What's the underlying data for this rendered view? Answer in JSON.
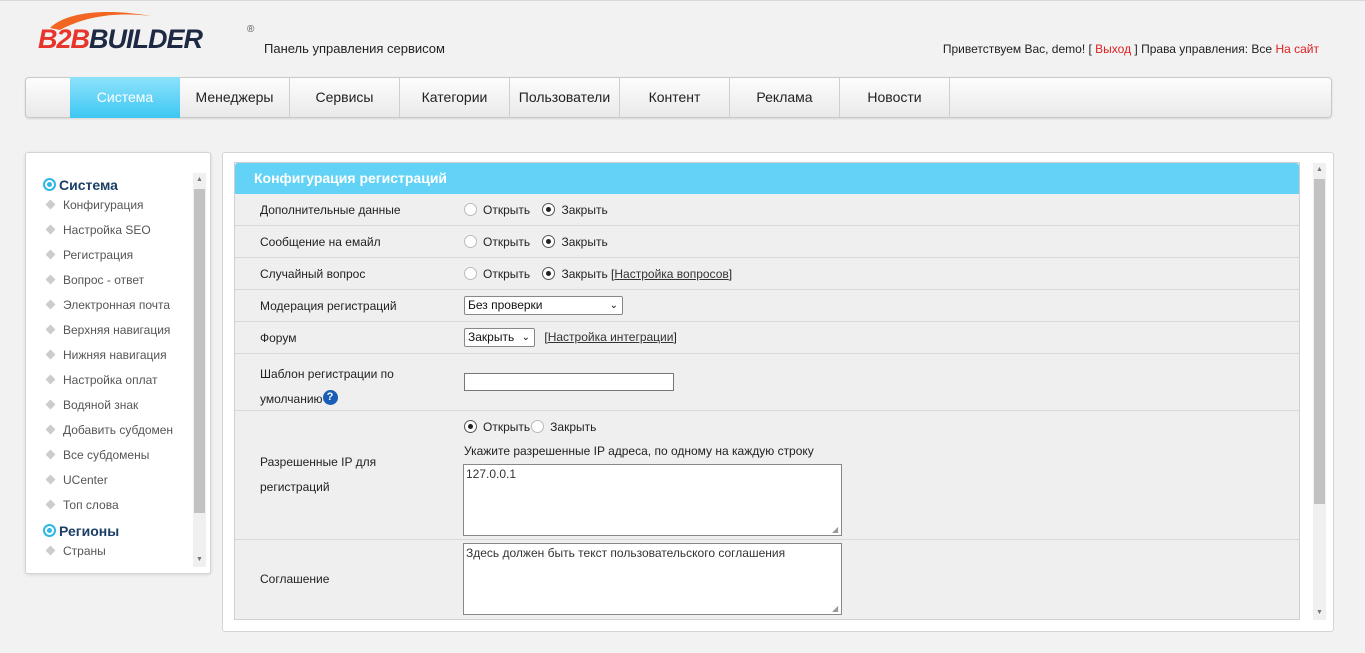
{
  "header": {
    "logo_text": "B2BBUILDER",
    "logo_reg": "®",
    "panel_title": "Панель управления сервисом",
    "welcome_prefix": "Приветствуем Вас, demo! [",
    "logout_label": "Выход",
    "rights_text": "] Права управления: Все",
    "site_link": "На сайт"
  },
  "nav": {
    "items": [
      {
        "label": "Система"
      },
      {
        "label": "Менеджеры"
      },
      {
        "label": "Сервисы"
      },
      {
        "label": "Категории"
      },
      {
        "label": "Пользователи"
      },
      {
        "label": "Контент"
      },
      {
        "label": "Реклама"
      },
      {
        "label": "Новости"
      }
    ]
  },
  "sidebar": {
    "group1": "Система",
    "items": [
      {
        "label": "Конфигурация"
      },
      {
        "label": "Настройка SEO"
      },
      {
        "label": "Регистрация"
      },
      {
        "label": "Вопрос - ответ"
      },
      {
        "label": "Электронная почта"
      },
      {
        "label": "Верхняя навигация"
      },
      {
        "label": "Нижняя навигация"
      },
      {
        "label": "Настройка оплат"
      },
      {
        "label": "Водяной знак"
      },
      {
        "label": "Добавить субдомен"
      },
      {
        "label": "Все субдомены"
      },
      {
        "label": "UCenter"
      },
      {
        "label": "Топ слова"
      }
    ],
    "group2": "Регионы",
    "group2_items": [
      {
        "label": "Страны"
      }
    ]
  },
  "form": {
    "title": "Конфигурация регистраций",
    "opt_open": "Открыть",
    "opt_close": "Закрыть",
    "rows": {
      "extra_data": {
        "label": "Дополнительные данные",
        "selected": "Закрыть"
      },
      "email_message": {
        "label": "Сообщение на емайл",
        "selected": "Закрыть"
      },
      "random_question": {
        "label": "Случайный вопрос",
        "selected": "Закрыть",
        "link": "Настройка вопросов"
      },
      "moderation": {
        "label": "Модерация регистраций",
        "value": "Без проверки"
      },
      "forum": {
        "label": "Форум",
        "value": "Закрыть",
        "link": "Настройка интеграции"
      },
      "template": {
        "label_line1": "Шаблон регистрации по",
        "label_line2": "умолчанию",
        "help_icon": "question-icon",
        "value": ""
      },
      "allowed_ip": {
        "label_line1": "Разрешенные IP для",
        "label_line2": "регистраций",
        "selected": "Открыть",
        "hint": "Укажите разрешенные IP адреса, по одному на каждую строку",
        "value": "127.0.0.1"
      },
      "agreement": {
        "label": "Соглашение",
        "value": "Здесь должен быть текст пользовательского соглашения"
      }
    }
  },
  "colors": {
    "accent": "#62d3f7",
    "nav_active": "#3cc7f2",
    "link_red": "#e02020",
    "logo_red": "#e8352b",
    "logo_dark": "#1e2a44"
  }
}
